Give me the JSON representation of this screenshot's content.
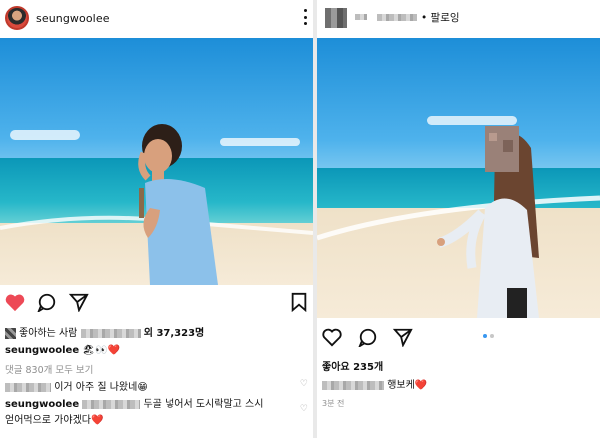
{
  "left_post": {
    "username": "seungwoolee",
    "likes_line": {
      "prefix": "좋아하는 사람",
      "suffix": "외 37,323명"
    },
    "caption": {
      "username": "seungwoolee",
      "emoji": "🏖👀❤️"
    },
    "view_comments": "댓글 830개 모두 보기",
    "comments": [
      {
        "text": "이거 아주 질 나왔네😁"
      },
      {
        "username": "seungwoolee",
        "text": "두골 넣어서 도시락말고 스시"
      },
      {
        "text": "얻어먹으로 가야겠다❤️"
      }
    ]
  },
  "right_post": {
    "header_label": "팔로잉",
    "likes": "좋아요 235개",
    "caption_text": "행보케❤️",
    "timestamp": "3분 전"
  },
  "colors": {
    "like_red": "#ed4956",
    "dot_active": "#3897f0"
  },
  "icons": [
    "heart-icon",
    "comment-icon",
    "share-icon",
    "bookmark-icon",
    "more-icon"
  ]
}
